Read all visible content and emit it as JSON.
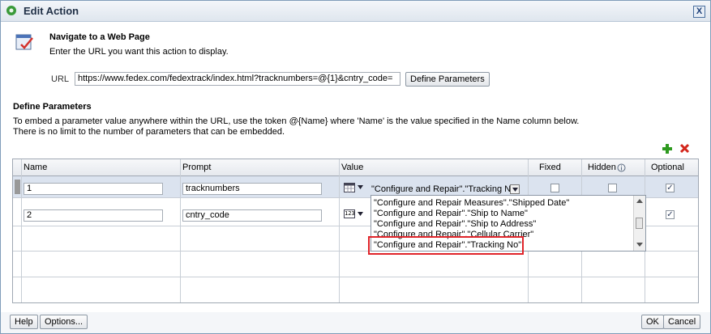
{
  "dialog": {
    "title": "Edit Action",
    "close_label": "X"
  },
  "section1": {
    "heading": "Navigate to a Web Page",
    "subtitle": "Enter the URL you want this action to display.",
    "url_label": "URL",
    "url_value": "https://www.fedex.com/fedextrack/index.html?tracknumbers=@{1}&cntry_code=",
    "define_params_button": "Define Parameters"
  },
  "section2": {
    "heading": "Define Parameters",
    "desc_line1": "To embed a parameter value anywhere within the URL, use the token @{Name} where 'Name' is the value specified in the Name column below.",
    "desc_line2": "There is no limit to the number of parameters that can be embedded."
  },
  "table": {
    "columns": [
      "Name",
      "Prompt",
      "Value",
      "Fixed",
      "Hidden",
      "Optional"
    ],
    "rows": [
      {
        "name": "1",
        "prompt": "tracknumbers",
        "value": "\"Configure and Repair\".\"Tracking No\"",
        "fixed": false,
        "hidden": false,
        "optional": true
      },
      {
        "name": "2",
        "prompt": "cntry_code",
        "value": "",
        "fixed": false,
        "hidden": false,
        "optional": true
      }
    ]
  },
  "dropdown": {
    "options": [
      "\"Configure and Repair Measures\".\"Shipped Date\"",
      "\"Configure and Repair\".\"Ship to Name\"",
      "\"Configure and Repair\".\"Ship to Address\"",
      "\"Configure and Repair\".\"Cellular Carrier\"",
      "\"Configure and Repair\".\"Tracking No\""
    ],
    "highlighted_index": 4
  },
  "footer": {
    "help": "Help",
    "options": "Options...",
    "ok": "OK",
    "cancel": "Cancel"
  },
  "colors": {
    "highlight_border": "#e0242a",
    "selected_row": "#dbe3ef",
    "add_icon": "#2e9a1f",
    "delete_icon": "#d3261b"
  }
}
